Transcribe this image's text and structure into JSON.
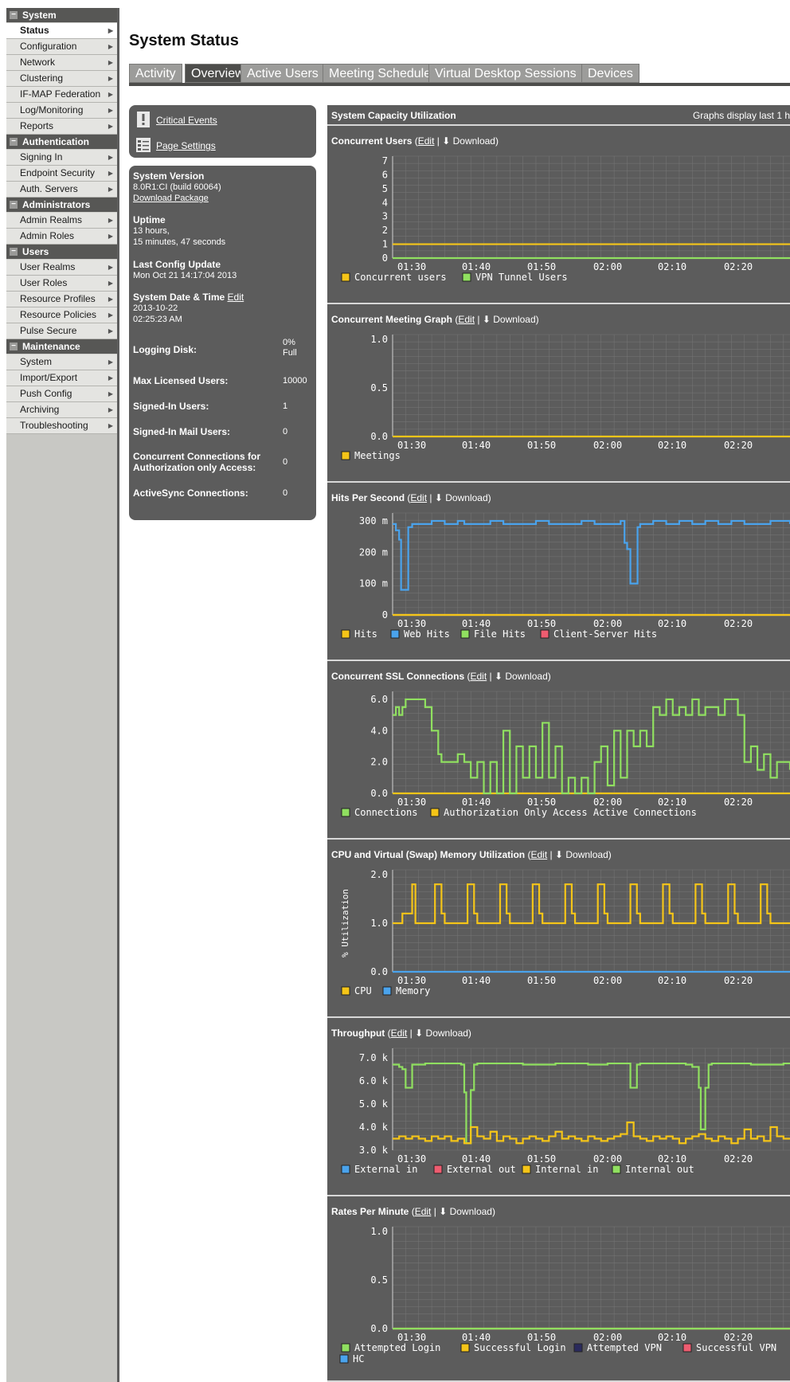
{
  "sidebar": {
    "sections": [
      {
        "label": "System",
        "items": [
          {
            "label": "Status",
            "active": true
          },
          {
            "label": "Configuration"
          },
          {
            "label": "Network"
          },
          {
            "label": "Clustering"
          },
          {
            "label": "IF-MAP Federation"
          },
          {
            "label": "Log/Monitoring"
          },
          {
            "label": "Reports"
          }
        ]
      },
      {
        "label": "Authentication",
        "items": [
          {
            "label": "Signing In"
          },
          {
            "label": "Endpoint Security"
          },
          {
            "label": "Auth. Servers"
          }
        ]
      },
      {
        "label": "Administrators",
        "items": [
          {
            "label": "Admin Realms"
          },
          {
            "label": "Admin Roles"
          }
        ]
      },
      {
        "label": "Users",
        "items": [
          {
            "label": "User Realms"
          },
          {
            "label": "User Roles"
          },
          {
            "label": "Resource Profiles"
          },
          {
            "label": "Resource Policies"
          },
          {
            "label": "Pulse Secure"
          }
        ]
      },
      {
        "label": "Maintenance",
        "items": [
          {
            "label": "System"
          },
          {
            "label": "Import/Export"
          },
          {
            "label": "Push Config"
          },
          {
            "label": "Archiving"
          },
          {
            "label": "Troubleshooting"
          }
        ]
      }
    ]
  },
  "page_title": "System Status",
  "tabs": [
    {
      "label": "Activity",
      "active": false
    },
    {
      "label": "Overview",
      "active": true
    },
    {
      "label": "Active Users",
      "active": false
    },
    {
      "label": "Meeting Schedule",
      "active": false
    },
    {
      "label": "Virtual Desktop Sessions",
      "active": false
    },
    {
      "label": "Devices",
      "active": false
    }
  ],
  "links_panel": {
    "critical_events": "Critical Events",
    "page_settings": "Page Settings"
  },
  "info": {
    "system_version_label": "System Version",
    "system_version_value": "8.0R1:CI (build 60064)",
    "download_package": "Download Package",
    "uptime_label": "Uptime",
    "uptime_line1": "13 hours,",
    "uptime_line2": "15 minutes, 47 seconds",
    "last_config_label": "Last Config Update",
    "last_config_value": "Mon Oct 21 14:17:04 2013",
    "date_time_label": "System Date & Time",
    "date_time_edit": "Edit",
    "date_value": "2013-10-22",
    "time_value": "02:25:23 AM",
    "logging_disk_label": "Logging Disk:",
    "logging_disk_value1": "0%",
    "logging_disk_value2": "Full",
    "max_licensed_label": "Max Licensed Users:",
    "max_licensed_value": "10000",
    "signed_in_label": "Signed-In Users:",
    "signed_in_value": "1",
    "signed_in_mail_label": "Signed-In Mail Users:",
    "signed_in_mail_value": "0",
    "concurrent_conn_label1": "Concurrent Connections for",
    "concurrent_conn_label2": "Authorization only Access:",
    "concurrent_conn_value": "0",
    "activesync_label": "ActiveSync Connections:",
    "activesync_value": "0"
  },
  "capacity": {
    "title": "System Capacity Utilization",
    "note": "Graphs display last 1 h"
  },
  "labels": {
    "edit": "Edit",
    "download": "Download"
  },
  "chart_data": [
    {
      "type": "line",
      "title": "Concurrent Users",
      "x_ticks": [
        "01:30",
        "01:40",
        "01:50",
        "02:00",
        "02:10",
        "02:20"
      ],
      "y_ticks": [
        "7",
        "6",
        "5",
        "4",
        "3",
        "2",
        "1",
        "0"
      ],
      "ylim": [
        0,
        7
      ],
      "series": [
        {
          "name": "Concurrent users",
          "color": "#f5c518",
          "x": [
            0,
            61
          ],
          "y": [
            1,
            1
          ]
        },
        {
          "name": "VPN Tunnel Users",
          "color": "#90e060",
          "x": [
            0,
            61
          ],
          "y": [
            0,
            0
          ]
        }
      ]
    },
    {
      "type": "line",
      "title": "Concurrent Meeting Graph",
      "x_ticks": [
        "01:30",
        "01:40",
        "01:50",
        "02:00",
        "02:10",
        "02:20"
      ],
      "y_ticks": [
        "1.0",
        "0.5",
        "0.0"
      ],
      "ylim": [
        0,
        1
      ],
      "series": [
        {
          "name": "Meetings",
          "color": "#f5c518",
          "x": [
            0,
            61
          ],
          "y": [
            0,
            0
          ]
        }
      ]
    },
    {
      "type": "line",
      "title": "Hits Per Second",
      "x_ticks": [
        "01:30",
        "01:40",
        "01:50",
        "02:00",
        "02:10",
        "02:20"
      ],
      "y_ticks": [
        "300 m",
        "200 m",
        "100 m",
        "0"
      ],
      "ylim": [
        0,
        0.31
      ],
      "series": [
        {
          "name": "Hits",
          "color": "#f5c518",
          "x": [
            0,
            61
          ],
          "y": [
            0,
            0
          ]
        },
        {
          "name": "Web Hits",
          "color": "#4aa3ec",
          "x": [
            0,
            0.5,
            1,
            1.3,
            2,
            2.4,
            3,
            5,
            6,
            8,
            10,
            11,
            13,
            15,
            17,
            20,
            22,
            24,
            26,
            29,
            31,
            33,
            35,
            35.6,
            36,
            36.5,
            37,
            37.6,
            38,
            40,
            42,
            44,
            46,
            48,
            50,
            52,
            54,
            56,
            58,
            61
          ],
          "y": [
            0.29,
            0.27,
            0.24,
            0.08,
            0.08,
            0.28,
            0.29,
            0.29,
            0.3,
            0.29,
            0.3,
            0.29,
            0.29,
            0.3,
            0.29,
            0.29,
            0.3,
            0.29,
            0.29,
            0.3,
            0.29,
            0.29,
            0.3,
            0.23,
            0.21,
            0.1,
            0.1,
            0.28,
            0.29,
            0.3,
            0.29,
            0.3,
            0.29,
            0.3,
            0.29,
            0.3,
            0.29,
            0.29,
            0.3,
            0.29
          ]
        },
        {
          "name": "File Hits",
          "color": "#90e060",
          "x": [
            0,
            61
          ],
          "y": [
            0,
            0
          ]
        },
        {
          "name": "Client-Server Hits",
          "color": "#ee5c70",
          "x": [
            0,
            61
          ],
          "y": [
            0,
            0
          ]
        }
      ]
    },
    {
      "type": "line",
      "title": "Concurrent SSL Connections",
      "x_ticks": [
        "01:30",
        "01:40",
        "01:50",
        "02:00",
        "02:10",
        "02:20"
      ],
      "y_ticks": [
        "6.0",
        "4.0",
        "2.0",
        "0.0"
      ],
      "ylim": [
        0,
        6.2
      ],
      "series": [
        {
          "name": "Connections",
          "color": "#90e060",
          "x": [
            0,
            0.5,
            1,
            1.5,
            2,
            3,
            4,
            5,
            6,
            7,
            7.5,
            8,
            9,
            10,
            11,
            12,
            13,
            14,
            15,
            16,
            17,
            18,
            19,
            20,
            21,
            22,
            23,
            24,
            25,
            26,
            27,
            28,
            29,
            30,
            31,
            32,
            33,
            34,
            35,
            36,
            37,
            38,
            39,
            40,
            41,
            42,
            43,
            44,
            45,
            46,
            47,
            48,
            49,
            50,
            51,
            52,
            53,
            54,
            55,
            56,
            57,
            58,
            59,
            60,
            61
          ],
          "y": [
            5.0,
            5.5,
            5.0,
            5.5,
            6.0,
            6.0,
            6.0,
            5.5,
            4.0,
            2.5,
            2.0,
            2.0,
            2.0,
            2.5,
            2.0,
            1.0,
            2.0,
            0.0,
            2.0,
            0.0,
            4.0,
            0.0,
            3.0,
            1.0,
            3.0,
            1.0,
            4.5,
            1.0,
            3.0,
            0.0,
            1.0,
            0.0,
            1.0,
            0.0,
            2.0,
            3.0,
            0.5,
            4.0,
            1.0,
            4.0,
            3.0,
            4.0,
            3.0,
            5.5,
            5.0,
            6.0,
            5.0,
            5.5,
            5.0,
            6.0,
            5.0,
            5.5,
            5.5,
            5.0,
            6.0,
            6.0,
            5.0,
            2.0,
            3.0,
            1.5,
            2.5,
            1.0,
            2.0,
            2.0,
            1.5
          ]
        },
        {
          "name": "Authorization Only Access Active Connections",
          "color": "#f5c518",
          "x": [
            0,
            61
          ],
          "y": [
            0,
            0
          ]
        }
      ]
    },
    {
      "type": "line",
      "title": "CPU and Virtual (Swap) Memory Utilization",
      "ylabel": "% Utilization",
      "x_ticks": [
        "01:30",
        "01:40",
        "01:50",
        "02:00",
        "02:10",
        "02:20"
      ],
      "y_ticks": [
        "2.0",
        "1.0",
        "0.0"
      ],
      "ylim": [
        0,
        2
      ],
      "series": [
        {
          "name": "CPU",
          "color": "#f5c518",
          "x": [
            0,
            1,
            1.5,
            2.5,
            3,
            3.5,
            6,
            6.5,
            7,
            7.5,
            8,
            11,
            11.5,
            12,
            12.5,
            13,
            16,
            16.5,
            17,
            17.5,
            18,
            21,
            21.5,
            22,
            22.5,
            23,
            26,
            26.5,
            27,
            27.5,
            28,
            31,
            31.5,
            32,
            32.5,
            33,
            36,
            36.5,
            37,
            37.5,
            38,
            41,
            41.5,
            42,
            42.5,
            43,
            46,
            46.5,
            47,
            47.5,
            48,
            51,
            51.5,
            52,
            52.5,
            53,
            56,
            56.5,
            57,
            57.5,
            58,
            61
          ],
          "y": [
            1.0,
            1.0,
            1.2,
            1.2,
            1.8,
            1.0,
            1.0,
            1.8,
            1.8,
            1.2,
            1.0,
            1.0,
            1.8,
            1.8,
            1.2,
            1.0,
            1.0,
            1.8,
            1.8,
            1.2,
            1.0,
            1.0,
            1.8,
            1.8,
            1.2,
            1.0,
            1.0,
            1.8,
            1.8,
            1.2,
            1.0,
            1.0,
            1.8,
            1.8,
            1.2,
            1.0,
            1.0,
            1.8,
            1.8,
            1.2,
            1.0,
            1.0,
            1.8,
            1.8,
            1.2,
            1.0,
            1.0,
            1.8,
            1.8,
            1.2,
            1.0,
            1.0,
            1.8,
            1.8,
            1.2,
            1.0,
            1.0,
            1.8,
            1.8,
            1.2,
            1.0,
            1.0
          ]
        },
        {
          "name": "Memory",
          "color": "#4aa3ec",
          "x": [
            0,
            61
          ],
          "y": [
            0,
            0
          ]
        }
      ]
    },
    {
      "type": "line",
      "title": "Throughput",
      "x_ticks": [
        "01:30",
        "01:40",
        "01:50",
        "02:00",
        "02:10",
        "02:20"
      ],
      "y_ticks": [
        "7.0 k",
        "6.0 k",
        "5.0 k",
        "4.0 k",
        "3.0 k"
      ],
      "ylim": [
        3000,
        7200
      ],
      "series": [
        {
          "name": "External in",
          "color": "#4aa3ec",
          "x": [],
          "y": []
        },
        {
          "name": "External out",
          "color": "#ee5c70",
          "x": [],
          "y": []
        },
        {
          "name": "Internal in",
          "color": "#f5c518",
          "x": [
            0,
            1,
            2,
            3,
            4,
            5,
            6,
            7,
            8,
            9,
            10,
            11,
            11.5,
            12,
            13,
            14,
            15,
            16,
            17,
            18,
            19,
            20,
            21,
            22,
            23,
            24,
            25,
            26,
            27,
            28,
            29,
            30,
            31,
            32,
            33,
            34,
            35,
            36,
            37,
            38,
            39,
            40,
            41,
            42,
            43,
            44,
            45,
            46,
            47,
            48,
            49,
            50,
            51,
            52,
            53,
            54,
            55,
            56,
            57,
            58,
            59,
            60,
            61
          ],
          "y": [
            3500,
            3600,
            3500,
            3600,
            3500,
            3400,
            3600,
            3500,
            3600,
            3400,
            3500,
            3300,
            3300,
            4000,
            3600,
            3500,
            3800,
            3400,
            3600,
            3500,
            3300,
            3500,
            3600,
            3500,
            3400,
            3600,
            3800,
            3500,
            3600,
            3500,
            3400,
            3600,
            3500,
            3400,
            3500,
            3600,
            3700,
            4200,
            3600,
            3500,
            3400,
            3600,
            3500,
            3600,
            3500,
            3300,
            3500,
            3600,
            3700,
            3500,
            3400,
            3600,
            3500,
            3300,
            3500,
            3900,
            3500,
            3600,
            3400,
            4000,
            3600,
            3500,
            3500
          ]
        },
        {
          "name": "Internal out",
          "color": "#90e060",
          "x": [
            0,
            1,
            1.5,
            2,
            2.5,
            3,
            5,
            8,
            10,
            10.5,
            11,
            11.3,
            11.6,
            12,
            12.5,
            13,
            15,
            20,
            25,
            30,
            33,
            36,
            36.5,
            37,
            37.5,
            38,
            40,
            45,
            46,
            47,
            47.3,
            47.6,
            48,
            48.5,
            49,
            50,
            55,
            60,
            61
          ],
          "y": [
            6700,
            6600,
            6500,
            5700,
            5700,
            6700,
            6750,
            6750,
            6750,
            6700,
            5500,
            3300,
            3300,
            5600,
            6700,
            6750,
            6750,
            6700,
            6750,
            6700,
            6750,
            6750,
            5700,
            5700,
            6700,
            6750,
            6750,
            6700,
            6600,
            5700,
            3900,
            3900,
            5700,
            6700,
            6750,
            6750,
            6700,
            6750,
            6750
          ]
        }
      ]
    },
    {
      "type": "line",
      "title": "Rates Per Minute",
      "x_ticks": [
        "01:30",
        "01:40",
        "01:50",
        "02:00",
        "02:10",
        "02:20"
      ],
      "y_ticks": [
        "1.0",
        "0.5",
        "0.0"
      ],
      "ylim": [
        0,
        1
      ],
      "series": [
        {
          "name": "Attempted Login",
          "color": "#90e060",
          "x": [
            0,
            61
          ],
          "y": [
            0,
            0
          ]
        },
        {
          "name": "Successful Login",
          "color": "#f5c518",
          "x": [
            0,
            61
          ],
          "y": [
            0,
            0
          ]
        },
        {
          "name": "Attempted VPN",
          "color": "#2a2a5c",
          "x": [
            0,
            61
          ],
          "y": [
            0,
            0
          ]
        },
        {
          "name": "Successful VPN",
          "color": "#ee5c70",
          "x": [
            0,
            61
          ],
          "y": [
            0,
            0
          ]
        },
        {
          "name": "HC",
          "color": "#4aa3ec",
          "x": [
            0,
            61
          ],
          "y": [
            0,
            0
          ]
        }
      ]
    }
  ]
}
